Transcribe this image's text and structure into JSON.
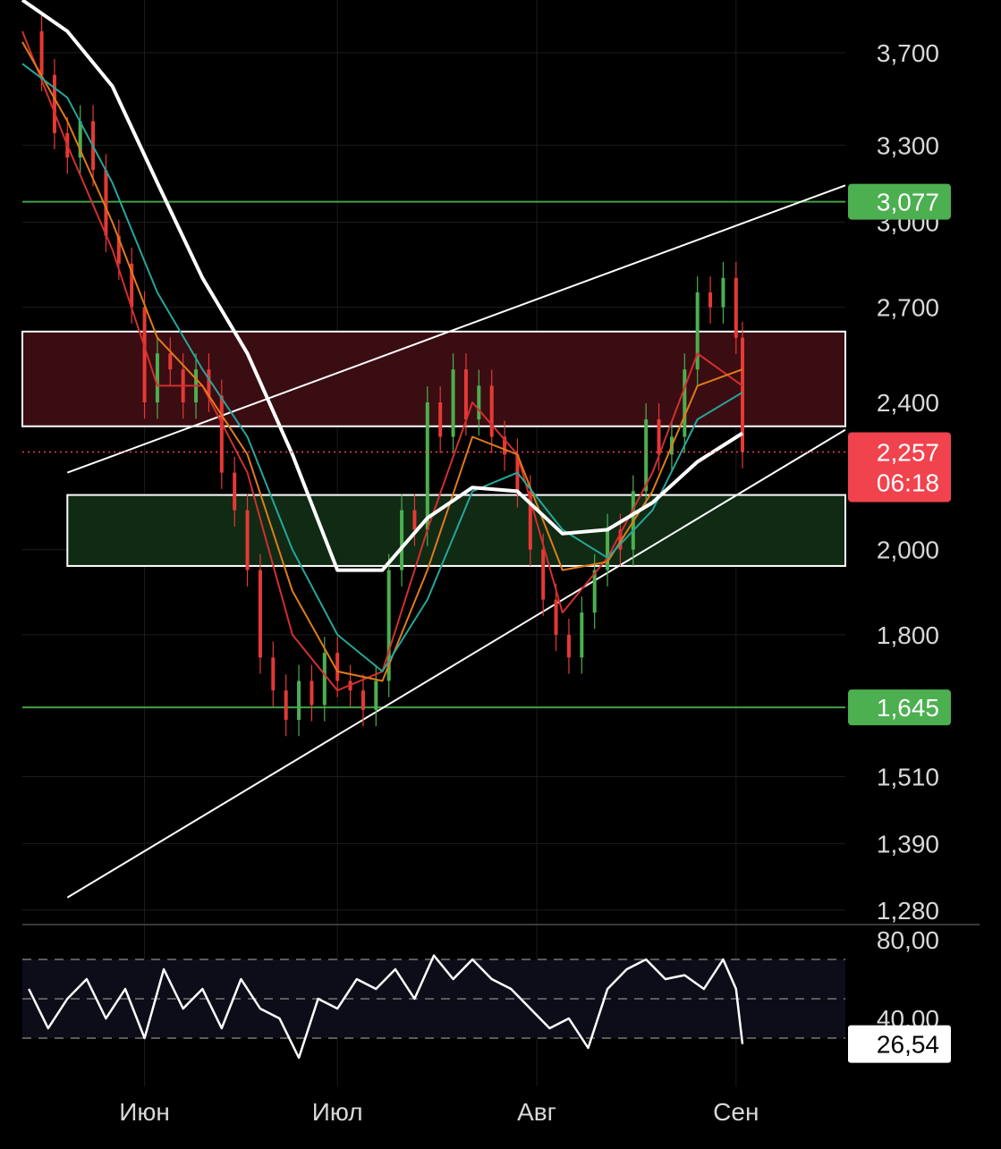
{
  "colors": {
    "background": "#000000",
    "grid": "#1c1c1e",
    "candle_up": "#4caf50",
    "candle_down": "#e53935",
    "ma_fast": "#d32f2f",
    "ma_mid": "#e07b1a",
    "ma_slow": "#26a69a",
    "ma_long": "#ffffff",
    "level_line": "#43a047",
    "resistance_zone": "#3a0d12",
    "support_zone": "#102a14",
    "price_badge": "#f0434e",
    "level_badge": "#4caf50",
    "axis_text": "#d8d8d8"
  },
  "chart_data": {
    "type": "line",
    "title": "",
    "xlabel": "",
    "ylabel": "",
    "scale": "log",
    "ylim": [
      1260,
      3950
    ],
    "y_ticks": [
      "3,700",
      "3,300",
      "3,000",
      "2,700",
      "2,400",
      "2,000",
      "1,800",
      "1,510",
      "1,390",
      "1,280"
    ],
    "y_tick_values": [
      3700,
      3300,
      3000,
      2700,
      2400,
      2000,
      1800,
      1510,
      1390,
      1280
    ],
    "x_ticks": [
      "Июн",
      "Июл",
      "Авг",
      "Сен"
    ],
    "x_tick_dates": [
      "2024-06-01",
      "2024-07-01",
      "2024-08-01",
      "2024-09-01"
    ],
    "x_range": [
      "2024-05-13",
      "2024-09-18"
    ],
    "grid": true,
    "series": [
      {
        "style": "candles-close",
        "color": "#e53935",
        "x": [
          "2024-05-14",
          "2024-05-16",
          "2024-05-18",
          "2024-05-20",
          "2024-05-22",
          "2024-05-24",
          "2024-05-26",
          "2024-05-28",
          "2024-05-30",
          "2024-06-01",
          "2024-06-03",
          "2024-06-05",
          "2024-06-07",
          "2024-06-09",
          "2024-06-11",
          "2024-06-13",
          "2024-06-15",
          "2024-06-17",
          "2024-06-19",
          "2024-06-21",
          "2024-06-23",
          "2024-06-25",
          "2024-06-27",
          "2024-06-29",
          "2024-07-01",
          "2024-07-03",
          "2024-07-05",
          "2024-07-07",
          "2024-07-09",
          "2024-07-11",
          "2024-07-13",
          "2024-07-15",
          "2024-07-17",
          "2024-07-19",
          "2024-07-21",
          "2024-07-23",
          "2024-07-25",
          "2024-07-27",
          "2024-07-29",
          "2024-07-31",
          "2024-08-02",
          "2024-08-04",
          "2024-08-06",
          "2024-08-08",
          "2024-08-10",
          "2024-08-12",
          "2024-08-14",
          "2024-08-16",
          "2024-08-18",
          "2024-08-20",
          "2024-08-22",
          "2024-08-24",
          "2024-08-26",
          "2024-08-28",
          "2024-08-30",
          "2024-09-01",
          "2024-09-02"
        ],
        "values": [
          3800,
          3600,
          3350,
          3250,
          3400,
          3200,
          2950,
          2850,
          2700,
          2400,
          2550,
          2500,
          2400,
          2500,
          2420,
          2200,
          2100,
          1950,
          1750,
          1680,
          1620,
          1700,
          1650,
          1760,
          1700,
          1680,
          1640,
          1700,
          1950,
          2100,
          2050,
          2400,
          2300,
          2500,
          2350,
          2450,
          2300,
          2250,
          2150,
          2000,
          1880,
          1800,
          1750,
          1850,
          1950,
          2050,
          2000,
          2150,
          2350,
          2250,
          2300,
          2500,
          2750,
          2700,
          2800,
          2600,
          2257
        ]
      },
      {
        "name": "",
        "style": "ma",
        "color": "#d32f2f",
        "x": [
          "2024-05-13",
          "2024-05-20",
          "2024-05-27",
          "2024-06-03",
          "2024-06-10",
          "2024-06-17",
          "2024-06-24",
          "2024-07-01",
          "2024-07-08",
          "2024-07-15",
          "2024-07-22",
          "2024-07-29",
          "2024-08-05",
          "2024-08-12",
          "2024-08-19",
          "2024-08-26",
          "2024-09-02"
        ],
        "values": [
          3800,
          3300,
          2900,
          2450,
          2450,
          2200,
          1800,
          1680,
          1720,
          2050,
          2400,
          2250,
          1850,
          1980,
          2200,
          2550,
          2450
        ]
      },
      {
        "name": "",
        "style": "ma",
        "color": "#e07b1a",
        "x": [
          "2024-05-13",
          "2024-05-20",
          "2024-05-27",
          "2024-06-03",
          "2024-06-10",
          "2024-06-17",
          "2024-06-24",
          "2024-07-01",
          "2024-07-08",
          "2024-07-15",
          "2024-07-22",
          "2024-07-29",
          "2024-08-05",
          "2024-08-12",
          "2024-08-19",
          "2024-08-26",
          "2024-09-02"
        ],
        "values": [
          3750,
          3400,
          3000,
          2600,
          2450,
          2250,
          1900,
          1720,
          1700,
          1950,
          2300,
          2250,
          1950,
          1970,
          2150,
          2450,
          2500
        ]
      },
      {
        "name": "",
        "style": "ma",
        "color": "#26a69a",
        "x": [
          "2024-05-13",
          "2024-05-20",
          "2024-05-27",
          "2024-06-03",
          "2024-06-10",
          "2024-06-17",
          "2024-06-24",
          "2024-07-01",
          "2024-07-08",
          "2024-07-15",
          "2024-07-22",
          "2024-07-29",
          "2024-08-05",
          "2024-08-12",
          "2024-08-19",
          "2024-08-26",
          "2024-09-02"
        ],
        "values": [
          3650,
          3500,
          3150,
          2750,
          2500,
          2300,
          2000,
          1800,
          1720,
          1880,
          2150,
          2200,
          2050,
          1980,
          2100,
          2350,
          2430
        ]
      },
      {
        "name": "",
        "style": "ma",
        "color": "#ffffff",
        "x": [
          "2024-05-13",
          "2024-05-20",
          "2024-05-27",
          "2024-06-03",
          "2024-06-10",
          "2024-06-17",
          "2024-06-24",
          "2024-07-01",
          "2024-07-08",
          "2024-07-15",
          "2024-07-22",
          "2024-07-29",
          "2024-08-05",
          "2024-08-12",
          "2024-08-19",
          "2024-08-26",
          "2024-09-02"
        ],
        "values": [
          3950,
          3800,
          3550,
          3150,
          2800,
          2550,
          2250,
          1950,
          1950,
          2080,
          2160,
          2150,
          2040,
          2050,
          2120,
          2230,
          2310
        ]
      }
    ],
    "levels": [
      {
        "label": "3,077",
        "value": 3077
      },
      {
        "label": "1,645",
        "value": 1645
      }
    ],
    "zones": [
      {
        "kind": "resistance",
        "from": 2330,
        "to": 2620,
        "start": "2024-05-13"
      },
      {
        "kind": "support",
        "from": 1960,
        "to": 2140,
        "start": "2024-05-20"
      }
    ],
    "trend_lines": [
      {
        "from": [
          "2024-05-20",
          2200
        ],
        "to": [
          "2024-09-18",
          3140
        ]
      },
      {
        "from": [
          "2024-05-20",
          1300
        ],
        "to": [
          "2024-09-18",
          2320
        ]
      }
    ],
    "current_price": {
      "label": "2,257",
      "value": 2257,
      "countdown": "06:18"
    },
    "oscillator": {
      "ylim": [
        10,
        85
      ],
      "ticks": [
        "80,00",
        "40,00"
      ],
      "tick_values": [
        80,
        40
      ],
      "bands": [
        70,
        50,
        30
      ],
      "current_label": "26,54",
      "current": 26.54,
      "x": [
        "2024-05-14",
        "2024-05-17",
        "2024-05-20",
        "2024-05-23",
        "2024-05-26",
        "2024-05-29",
        "2024-06-01",
        "2024-06-04",
        "2024-06-07",
        "2024-06-10",
        "2024-06-13",
        "2024-06-16",
        "2024-06-19",
        "2024-06-22",
        "2024-06-25",
        "2024-06-28",
        "2024-07-01",
        "2024-07-04",
        "2024-07-07",
        "2024-07-10",
        "2024-07-13",
        "2024-07-16",
        "2024-07-19",
        "2024-07-22",
        "2024-07-25",
        "2024-07-28",
        "2024-07-31",
        "2024-08-03",
        "2024-08-06",
        "2024-08-09",
        "2024-08-12",
        "2024-08-15",
        "2024-08-18",
        "2024-08-21",
        "2024-08-24",
        "2024-08-27",
        "2024-08-30",
        "2024-09-01",
        "2024-09-02"
      ],
      "values": [
        55,
        35,
        50,
        60,
        40,
        55,
        30,
        65,
        45,
        55,
        35,
        60,
        45,
        40,
        20,
        50,
        45,
        60,
        55,
        65,
        50,
        72,
        60,
        70,
        60,
        55,
        45,
        35,
        40,
        25,
        55,
        65,
        70,
        60,
        62,
        55,
        70,
        55,
        27
      ]
    }
  }
}
